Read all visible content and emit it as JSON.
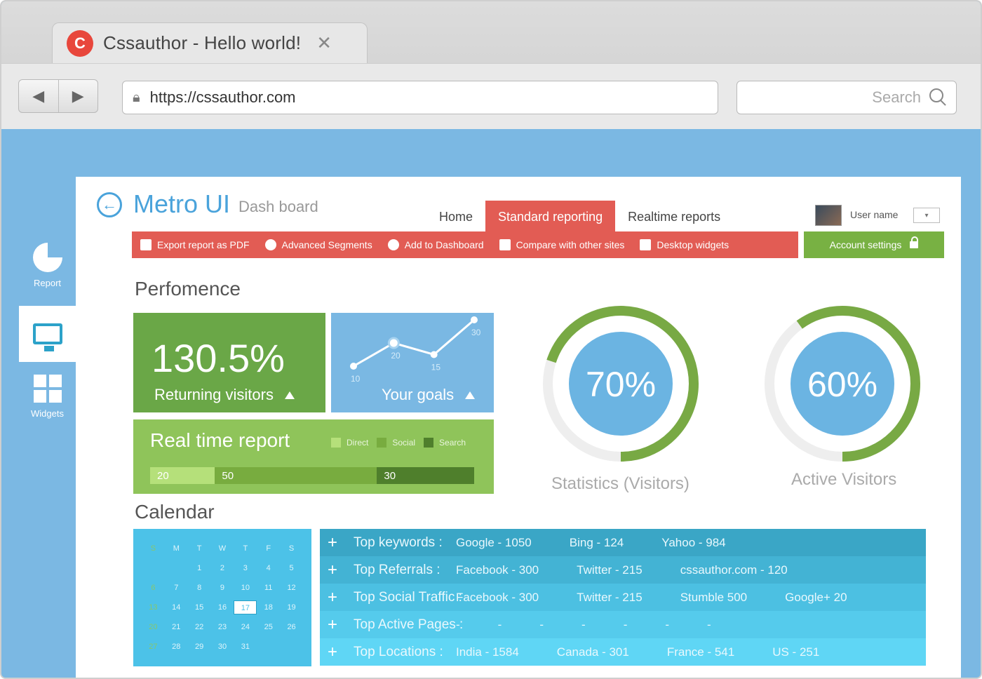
{
  "browser": {
    "tab_title": "Cssauthor -  Hello world!",
    "tab_logo_letter": "C",
    "url": "https://cssauthor.com",
    "search_placeholder": "Search"
  },
  "sidebar": {
    "items": [
      {
        "label": "Report",
        "icon": "pie-chart-icon"
      },
      {
        "label": "",
        "icon": "monitor-icon"
      },
      {
        "label": "Widgets",
        "icon": "widgets-grid-icon"
      }
    ]
  },
  "header": {
    "title": "Metro UI",
    "subtitle": "Dash board",
    "nav": [
      "Home",
      "Standard reporting",
      "Realtime reports"
    ],
    "user_name": "User name"
  },
  "toolbar": {
    "items": [
      "Export report as PDF",
      "Advanced Segments",
      "Add to Dashboard",
      "Compare with other sites",
      "Desktop widgets"
    ],
    "account": "Account settings"
  },
  "performance": {
    "title": "Perfomence",
    "returning_value": "130.5%",
    "returning_label": "Returning visitors",
    "goals_label": "Your goals",
    "goals_points": [
      10,
      20,
      15,
      30
    ],
    "goals_point_labels": [
      "10",
      "20",
      "15",
      "30"
    ]
  },
  "realtime": {
    "title": "Real time report",
    "legend": [
      "Direct",
      "Social",
      "Search"
    ],
    "values": [
      20,
      50,
      30
    ],
    "value_labels": [
      "20",
      "50",
      "30"
    ],
    "colors": [
      "#b5e07a",
      "#78ac3f",
      "#4f7f2c"
    ]
  },
  "donuts": [
    {
      "value": 70,
      "label": "70%",
      "caption": "Statistics (Visitors)"
    },
    {
      "value": 60,
      "label": "60%",
      "caption": "Active Visitors"
    }
  ],
  "calendar": {
    "title": "Calendar",
    "weekdays": [
      "S",
      "M",
      "T",
      "W",
      "T",
      "F",
      "S"
    ],
    "days": [
      "",
      "",
      "1",
      "2",
      "3",
      "4",
      "5",
      "6",
      "7",
      "8",
      "9",
      "10",
      "11",
      "12",
      "13",
      "14",
      "15",
      "16",
      "17",
      "18",
      "19",
      "20",
      "21",
      "22",
      "23",
      "24",
      "25",
      "26",
      "27",
      "28",
      "29",
      "30",
      "31"
    ],
    "today": "17"
  },
  "stats": [
    {
      "title": "Top keywords :",
      "values": [
        "Google  - 1050",
        "Bing  - 124",
        "Yahoo  - 984"
      ],
      "bg": "#3aa6c6"
    },
    {
      "title": "Top Referrals :",
      "values": [
        "Facebook  - 300",
        "Twitter   - 215",
        "cssauthor.com  - 120"
      ],
      "bg": "#43b3d4"
    },
    {
      "title": "Top Social Traffic :",
      "values": [
        "Facebook  - 300",
        "Twitter   - 215",
        "Stumble   500",
        "Google+  20"
      ],
      "bg": "#4cc0e2"
    },
    {
      "title": "Top Active Pages :",
      "values": [
        "-",
        "-",
        "-",
        "-",
        "-",
        "-",
        "-"
      ],
      "bg": "#55cbec"
    },
    {
      "title": "Top Locations :",
      "values": [
        "India  - 1584",
        "Canada  - 301",
        "France  - 541",
        "US  - 251"
      ],
      "bg": "#5fd6f5"
    }
  ]
}
